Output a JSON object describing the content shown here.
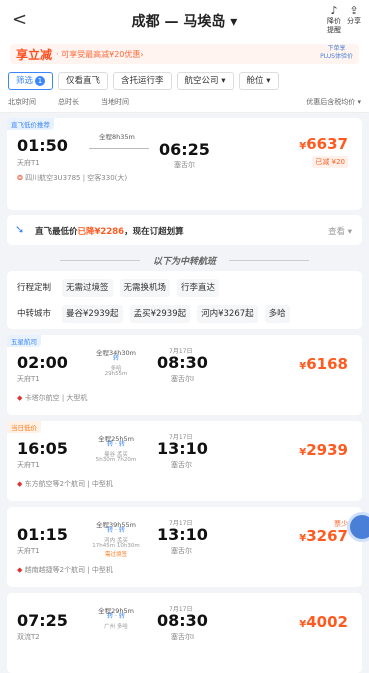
{
  "header": {
    "back": "<",
    "title": "成都 — 马埃岛 ▾",
    "price_alert": "降价\n提醒",
    "share": "分享"
  },
  "promo": {
    "logo": "享立减",
    "text": "· 可享受最高减¥20优惠›",
    "right_line1": "下单享",
    "right_line2": "PLUS体验价"
  },
  "filters": {
    "filter": "筛选",
    "filter_count": "1",
    "direct_only": "仅看直飞",
    "luggage": "含托运行李",
    "airline": "航空公司 ▾",
    "cabin": "舱位 ▾"
  },
  "sort": {
    "dep_time": "北京时间",
    "duration": "总时长",
    "local_time": "当地时间",
    "right": "优惠后含税均价 ▾"
  },
  "direct_card": {
    "tag": "直飞低价推荐",
    "dep_time": "01:50",
    "dep_airport": "天府T1",
    "duration": "全程8h35m",
    "arr_time": "06:25",
    "arr_airport": "塞舌尔",
    "price": "6637",
    "currency": "¥",
    "saved": "已减 ¥20",
    "airline": "四川航空3U3785 | 空客330(大)"
  },
  "low_bar": {
    "text_a": "直飞最低价",
    "text_b": "已降¥2286",
    "text_c": "，现在订超划算",
    "view": "查看 ▾"
  },
  "divider": "以下为中转航班",
  "tags_row1": [
    "行程定制",
    "无需过境签",
    "无需换机场",
    "行李直达"
  ],
  "tags_row2": [
    "中转城市",
    "曼谷¥2939起",
    "孟买¥2939起",
    "河内¥3267起",
    "多哈"
  ],
  "transfers": [
    {
      "tag": "五星航司",
      "tag_style": "blue",
      "dep_time": "02:00",
      "dep_airport": "天府T1",
      "duration": "全程34h30m",
      "via": "转",
      "via_city": "多哈",
      "layover": "29h55m",
      "arr_date": "7月17日",
      "arr_time": "08:30",
      "arr_airport": "塞舌尔I",
      "price": "6168",
      "airline": "卡塔尔航空 | 大型机",
      "remain": ""
    },
    {
      "tag": "当日低价",
      "tag_style": "orange",
      "dep_time": "16:05",
      "dep_airport": "天府T1",
      "duration": "全程25h5m",
      "via": "转 · 转",
      "via_city": "曼谷  孟买",
      "layover": "5h30m  7h20m",
      "arr_date": "7月17日",
      "arr_time": "13:10",
      "arr_airport": "塞舌尔",
      "price": "2939",
      "airline": "东方航空等2个航司 | 中型机",
      "remain": ""
    },
    {
      "tag": "",
      "tag_style": "",
      "dep_time": "01:15",
      "dep_airport": "天府T1",
      "duration": "全程39h55m",
      "via": "转 · 转",
      "via_city": "河内  孟买",
      "layover": "17h45m  10h30m",
      "arr_date": "7月17日",
      "arr_time": "13:10",
      "arr_airport": "塞舌尔",
      "price": "3267",
      "airline": "越南越捷等2个航司 | 中型机",
      "remain": "票少",
      "extra": "需过境签"
    },
    {
      "tag": "",
      "tag_style": "",
      "dep_time": "07:25",
      "dep_airport": "双流T2",
      "duration": "全程29h5m",
      "via": "转 · 转",
      "via_city": "广州  多哈",
      "layover": "",
      "arr_date": "7月17日",
      "arr_time": "08:30",
      "arr_airport": "塞舌尔I",
      "price": "4002",
      "airline": "",
      "remain": ""
    }
  ],
  "colors": {
    "accent": "#3b86f7",
    "price": "#ff5a1f"
  }
}
